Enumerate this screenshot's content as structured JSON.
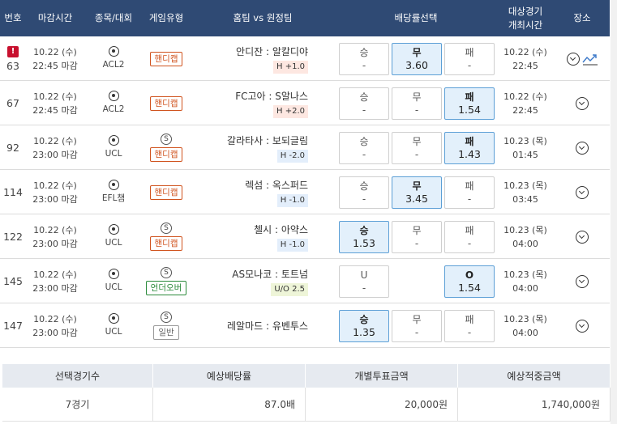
{
  "header": {
    "num": "번호",
    "deadline": "마감시간",
    "league": "종목/대회",
    "game_type": "게임유형",
    "matchup": "홈팀 vs 원정팀",
    "odds_select": "배당률선택",
    "target_time_1": "대상경기",
    "target_time_2": "개최시간",
    "venue": "장소"
  },
  "rows": [
    {
      "num": "63",
      "alert": "!",
      "date": "10.22 (수)",
      "deadline": "22:45 마감",
      "league": "ACL2",
      "s_badge": "",
      "game_type": "핸디캡",
      "game_class": "handi",
      "teams": "안디잔 : 알칼디야",
      "tag": "H +1.0",
      "tag_class": "h",
      "opts": [
        {
          "label": "승",
          "value": "-",
          "sel": false
        },
        {
          "label": "무",
          "value": "3.60",
          "sel": true
        },
        {
          "label": "패",
          "value": "-",
          "sel": false
        }
      ],
      "sched_date": "10.22 (수)",
      "sched_time": "22:45",
      "has_chart": true
    },
    {
      "num": "67",
      "alert": "",
      "date": "10.22 (수)",
      "deadline": "22:45 마감",
      "league": "ACL2",
      "s_badge": "",
      "game_type": "핸디캡",
      "game_class": "handi",
      "teams": "FC고아 : S알나스",
      "tag": "H +2.0",
      "tag_class": "h",
      "opts": [
        {
          "label": "승",
          "value": "-",
          "sel": false
        },
        {
          "label": "무",
          "value": "-",
          "sel": false
        },
        {
          "label": "패",
          "value": "1.54",
          "sel": true
        }
      ],
      "sched_date": "10.22 (수)",
      "sched_time": "22:45",
      "has_chart": false
    },
    {
      "num": "92",
      "alert": "",
      "date": "10.22 (수)",
      "deadline": "23:00 마감",
      "league": "UCL",
      "s_badge": "S",
      "game_type": "핸디캡",
      "game_class": "handi",
      "teams": "갈라타사 : 보되글림",
      "tag": "H -2.0",
      "tag_class": "hm",
      "opts": [
        {
          "label": "승",
          "value": "-",
          "sel": false
        },
        {
          "label": "무",
          "value": "-",
          "sel": false
        },
        {
          "label": "패",
          "value": "1.43",
          "sel": true
        }
      ],
      "sched_date": "10.23 (목)",
      "sched_time": "01:45",
      "has_chart": false
    },
    {
      "num": "114",
      "alert": "",
      "date": "10.22 (수)",
      "deadline": "23:00 마감",
      "league": "EFL챔",
      "s_badge": "",
      "game_type": "핸디캡",
      "game_class": "handi",
      "teams": "렉섬 : 옥스퍼드",
      "tag": "H -1.0",
      "tag_class": "hm",
      "opts": [
        {
          "label": "승",
          "value": "-",
          "sel": false
        },
        {
          "label": "무",
          "value": "3.45",
          "sel": true
        },
        {
          "label": "패",
          "value": "-",
          "sel": false
        }
      ],
      "sched_date": "10.23 (목)",
      "sched_time": "03:45",
      "has_chart": false
    },
    {
      "num": "122",
      "alert": "",
      "date": "10.22 (수)",
      "deadline": "23:00 마감",
      "league": "UCL",
      "s_badge": "S",
      "game_type": "핸디캡",
      "game_class": "handi",
      "teams": "첼시 : 아약스",
      "tag": "H -1.0",
      "tag_class": "hm",
      "opts": [
        {
          "label": "승",
          "value": "1.53",
          "sel": true
        },
        {
          "label": "무",
          "value": "-",
          "sel": false
        },
        {
          "label": "패",
          "value": "-",
          "sel": false
        }
      ],
      "sched_date": "10.23 (목)",
      "sched_time": "04:00",
      "has_chart": false
    },
    {
      "num": "145",
      "alert": "",
      "date": "10.22 (수)",
      "deadline": "23:00 마감",
      "league": "UCL",
      "s_badge": "S",
      "game_type": "언더오버",
      "game_class": "under",
      "teams": "AS모나코 : 토트넘",
      "tag": "U/O 2.5",
      "tag_class": "uo",
      "opts": [
        {
          "label": "U",
          "value": "-",
          "sel": false
        },
        {
          "label": "",
          "value": "",
          "sel": false,
          "hidden": true
        },
        {
          "label": "O",
          "value": "1.54",
          "sel": true
        }
      ],
      "sched_date": "10.23 (목)",
      "sched_time": "04:00",
      "has_chart": false
    },
    {
      "num": "147",
      "alert": "",
      "date": "10.22 (수)",
      "deadline": "23:00 마감",
      "league": "UCL",
      "s_badge": "S",
      "game_type": "일반",
      "game_class": "gen",
      "teams": "레알마드 : 유벤투스",
      "tag": "",
      "tag_class": "",
      "opts": [
        {
          "label": "승",
          "value": "1.35",
          "sel": true
        },
        {
          "label": "무",
          "value": "-",
          "sel": false
        },
        {
          "label": "패",
          "value": "-",
          "sel": false
        }
      ],
      "sched_date": "10.23 (목)",
      "sched_time": "04:00",
      "has_chart": false
    }
  ],
  "summary": {
    "headers": [
      "선택경기수",
      "예상배당률",
      "개별투표금액",
      "예상적중금액"
    ],
    "values": [
      "7경기",
      "87.0배",
      "20,000원",
      "1,740,000원"
    ]
  },
  "colors": {
    "header_bg": "#2f4a74",
    "selected_bg": "#e3f0fb",
    "handicap": "#d0531e",
    "underover": "#2a8a3a"
  }
}
